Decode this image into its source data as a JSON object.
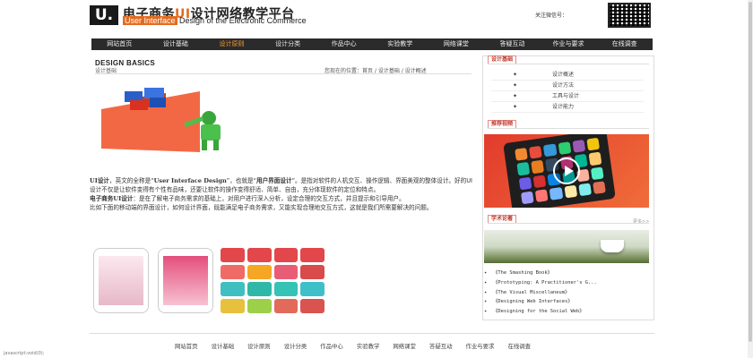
{
  "header": {
    "logo_mark": "U.",
    "title_prefix": "电子商务",
    "title_ui": "UI",
    "title_suffix": "设计网络教学平台",
    "subtitle_tag": "User Interface",
    "subtitle_rest": " Design of the Electronic Commerce",
    "wechat_label": "关注微信号："
  },
  "nav": {
    "items": [
      "网站首页",
      "设计基础",
      "设计原则",
      "设计分类",
      "作品中心",
      "实验教学",
      "网络课堂",
      "答疑互动",
      "作业与要求",
      "在线调查"
    ],
    "active_index": 2
  },
  "main": {
    "title": "DESIGN BASICS",
    "subtitle": "设计基础",
    "breadcrumb": "您现在的位置：首页 / 设计基础 / 设计概述",
    "paragraphs": [
      {
        "b1": "UI设计",
        "t1": "，英文的全称是“",
        "b2": "User Interface Design",
        "t2": "”，也就是“",
        "b3": "用户界面设计",
        "t3": "”。是指对软件的人机交互、操作逻辑、界面美观的整体设计。好的UI设计不仅是让软件变得有个性有品味，还要让软件的操作变得舒适、简单、自由，充分体现软件的定位和特点。"
      },
      {
        "b1": "电子商务UI设计",
        "t1": "：是在了解电子商务需求的基础上，对用户进行深入分析，设定合理的交互方式，并且提示和引导用户。"
      },
      {
        "t1": "比如下面的移动端的界面设计，如何设计界面，既能满足电子商务需求，又能实现合理地交互方式，这就是我们所需要解决的问题。"
      }
    ]
  },
  "sidebar": {
    "categories_head": "设计基础",
    "categories": [
      "设计概述",
      "设计方法",
      "工具与设计",
      "设计能力"
    ],
    "video_head": "推荐视频",
    "articles_head": "学术论著",
    "more": "更多>>",
    "books": [
      "《The Smashing Book》",
      "《Prototyping: A Practitioner's G...",
      "《The Visual Miscellaneum》",
      "《Designing Web Interfaces》",
      "《Designing for the Social Web》"
    ]
  },
  "footer": {
    "items": [
      "网站首页",
      "设计基础",
      "设计原则",
      "设计分类",
      "作品中心",
      "实验教学",
      "网络课堂",
      "答疑互动",
      "作业与要求",
      "在线调查"
    ]
  },
  "status_text": "javascript:void(0);",
  "colors": {
    "accent": "#e56b1f",
    "nav_bg": "#2b2b2b",
    "nav_active": "#f39a32",
    "head_red": "#c0392b"
  }
}
